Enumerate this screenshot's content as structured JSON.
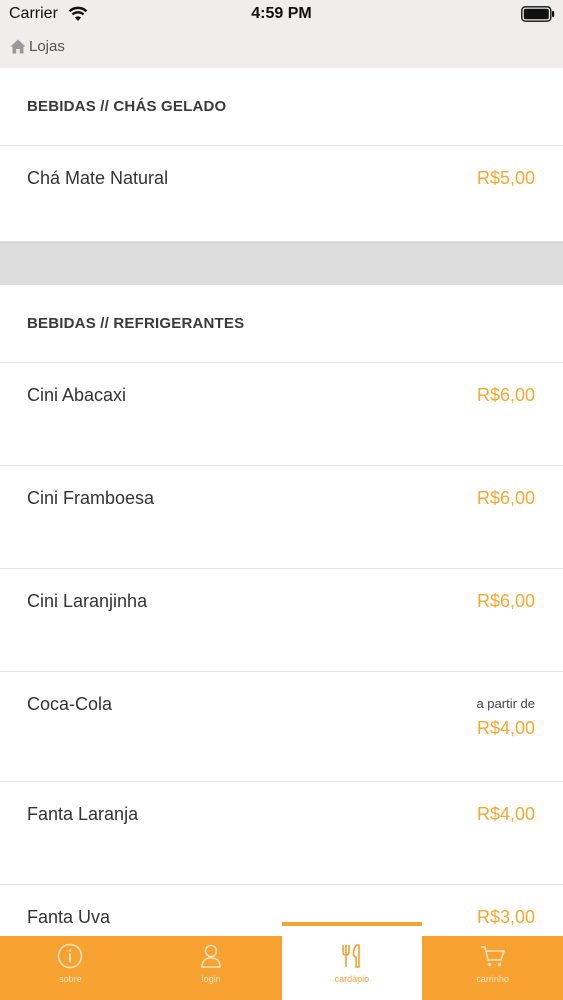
{
  "status": {
    "carrier": "Carrier",
    "time": "4:59 PM"
  },
  "nav": {
    "back_label": "Lojas"
  },
  "sections": [
    {
      "title": "BEBIDAS // CHÁS GELADO",
      "items": [
        {
          "name": "Chá Mate Natural",
          "price": "R$5,00"
        }
      ]
    },
    {
      "title": "BEBIDAS // REFRIGERANTES",
      "items": [
        {
          "name": "Cini Abacaxi",
          "price": "R$6,00"
        },
        {
          "name": "Cini Framboesa",
          "price": "R$6,00"
        },
        {
          "name": "Cini Laranjinha",
          "price": "R$6,00"
        },
        {
          "name": "Coca-Cola",
          "prefix": "a partir de",
          "price": "R$4,00"
        },
        {
          "name": "Fanta Laranja",
          "price": "R$4,00"
        },
        {
          "name": "Fanta Uva",
          "price": "R$3,00"
        }
      ]
    }
  ],
  "tabs": [
    {
      "label": "sobre",
      "icon": "info-icon"
    },
    {
      "label": "login",
      "icon": "user-icon"
    },
    {
      "label": "cardápio",
      "icon": "cutlery-icon",
      "active": true
    },
    {
      "label": "carrinho",
      "icon": "cart-icon"
    }
  ],
  "colors": {
    "accent": "#f7a131",
    "price": "#f3a830",
    "bar_bg": "#efeeec"
  }
}
